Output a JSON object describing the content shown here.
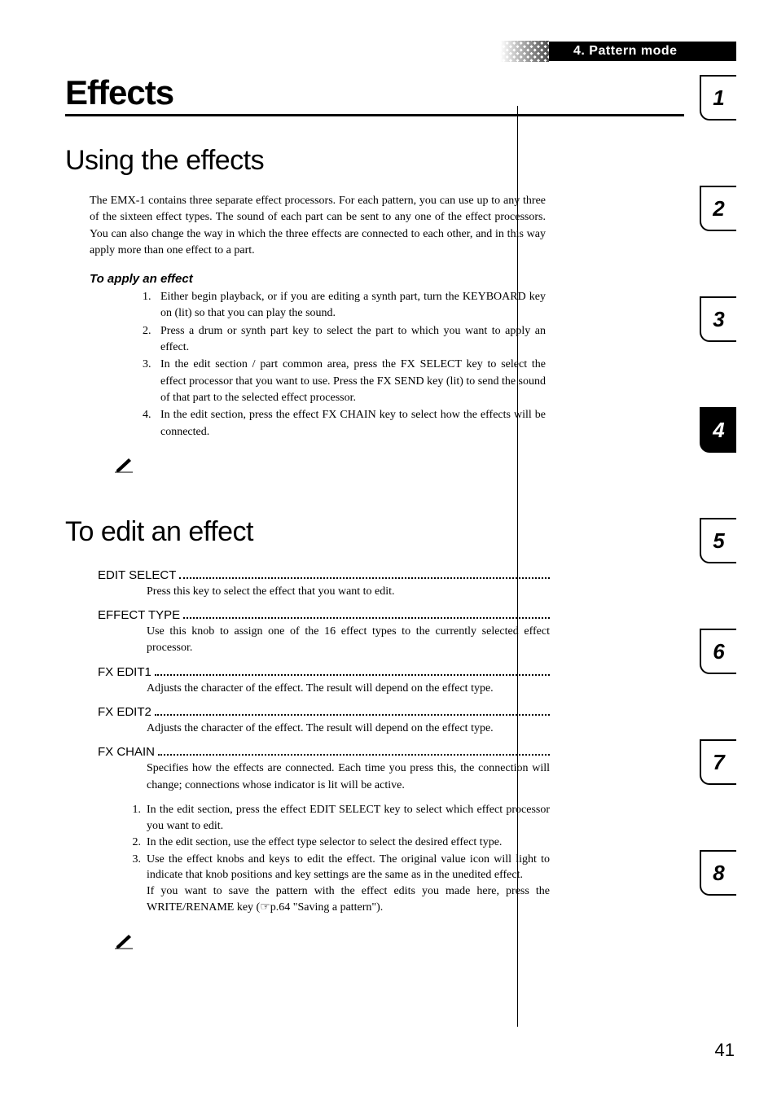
{
  "header_label": "4. Pattern mode",
  "main_title": "Effects",
  "section1": {
    "title": "Using the effects",
    "intro": "The EMX-1 contains three separate effect processors. For each pattern, you can use up to any three of the sixteen effect types. The sound of each part can be sent to any one of the effect processors.  You can also change the way in which the three effects are connected to each other, and in this way apply more than one effect to a part.",
    "sub_head": "To apply an effect",
    "steps": [
      "Either begin playback, or if you are editing a synth part, turn the KEYBOARD key on (lit) so that you can play the sound.",
      "Press a drum or synth part key to select the part to which you want to apply an effect.",
      "In the edit section / part common area, press the FX SELECT key to select the effect processor that you want to use. Press the FX SEND key (lit) to send the sound of that part to the selected effect processor.",
      "In the edit section, press the effect FX CHAIN key to select how the effects will be connected."
    ]
  },
  "section2": {
    "title": "To edit an effect",
    "items": [
      {
        "term": "EDIT SELECT",
        "desc": "Press this key to select the effect that you want to edit."
      },
      {
        "term": "EFFECT TYPE",
        "desc": "Use this knob to assign one of the 16 effect types to the currently selected effect processor."
      },
      {
        "term": "FX EDIT1",
        "desc": "Adjusts the character of the effect. The result will depend on the effect type."
      },
      {
        "term": "FX EDIT2",
        "desc": "Adjusts the character of the effect. The result will depend on the effect type."
      },
      {
        "term": "FX CHAIN",
        "desc": "Specifies how the effects are connected. Each time you press this, the connection will change; connections whose indicator is lit will be active."
      }
    ],
    "steps": [
      "In the edit section, press the effect EDIT SELECT key to select which effect processor you want to edit.",
      "In the edit section, use the effect type selector to select the desired effect type.",
      "Use the effect knobs and keys to edit the effect. The original value icon will light to indicate that knob positions and key settings are the same as in the unedited effect."
    ],
    "save_note": "If you want to save the pattern with the effect edits you made here, press the WRITE/RENAME key (☞p.64 \"Saving a pattern\")."
  },
  "tabs": [
    "1",
    "2",
    "3",
    "4",
    "5",
    "6",
    "7",
    "8"
  ],
  "active_tab_index": 3,
  "page_number": "41"
}
